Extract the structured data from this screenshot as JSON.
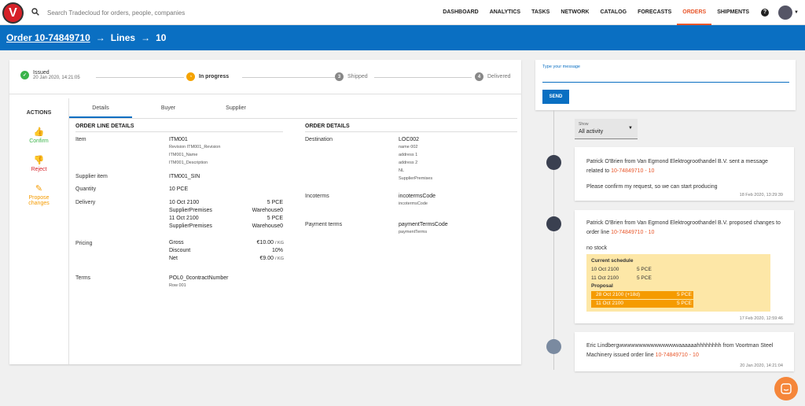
{
  "topbar": {
    "logo_letter": "V",
    "search_placeholder": "Search Tradecloud for orders, people, companies",
    "nav": [
      {
        "label": "DASHBOARD",
        "active": false
      },
      {
        "label": "ANALYTICS",
        "active": false
      },
      {
        "label": "TASKS",
        "active": false
      },
      {
        "label": "NETWORK",
        "active": false
      },
      {
        "label": "CATALOG",
        "active": false
      },
      {
        "label": "FORECASTS",
        "active": false
      },
      {
        "label": "ORDERS",
        "active": true
      },
      {
        "label": "SHIPMENTS",
        "active": false
      }
    ],
    "help_icon": "?",
    "accent_color": "#e8562a"
  },
  "breadcrumb": {
    "order": "Order 10-74849710",
    "lines": "Lines",
    "line_no": "10",
    "color": "#0a6fc2"
  },
  "stepper": {
    "issued": {
      "label": "Issued",
      "date": "20 Jan 2020, 14:21:05"
    },
    "in_progress": {
      "label": "In progress"
    },
    "shipped": {
      "number": "3",
      "label": "Shipped"
    },
    "delivered": {
      "number": "4",
      "label": "Delivered"
    }
  },
  "actions": {
    "title": "ACTIONS",
    "confirm": "Confirm",
    "reject": "Reject",
    "propose_line1": "Propose",
    "propose_line2": "changes"
  },
  "tabs": [
    "Details",
    "Buyer",
    "Supplier"
  ],
  "order_line": {
    "title": "ORDER LINE DETAILS",
    "item_label": "Item",
    "item": "ITM001",
    "item_revision": "Revision ITM001_Revision",
    "item_name": "ITM001_Name",
    "item_description": "ITM001_Description",
    "supplier_item_label": "Supplier item",
    "supplier_item": "ITM001_SIN",
    "quantity_label": "Quantity",
    "quantity": "10 PCE",
    "delivery_label": "Delivery",
    "delivery": [
      {
        "date": "10 Oct 2100",
        "qty": "5 PCE",
        "loc": "SupplierPremises",
        "wh": "Warehouse0"
      },
      {
        "date": "11 Oct 2100",
        "qty": "5 PCE",
        "loc": "SupplierPremises",
        "wh": "Warehouse0"
      }
    ],
    "pricing_label": "Pricing",
    "gross_label": "Gross",
    "gross": "€10.00",
    "gross_unit": "/ KG",
    "discount_label": "Discount",
    "discount": "10%",
    "net_label": "Net",
    "net": "€9.00",
    "net_unit": "/ KG",
    "terms_label": "Terms",
    "terms": "POL0_0contractNumber",
    "terms_row": "Row 001"
  },
  "order_details": {
    "title": "ORDER DETAILS",
    "destination_label": "Destination",
    "destination": "LOC002",
    "dest_name": "name 002",
    "dest_addr1": "address 1",
    "dest_addr2": "address 2",
    "dest_country": "NL",
    "dest_premises": "SupplierPremises",
    "incoterms_label": "Incoterms",
    "incoterms": "incotermsCode",
    "incoterms_sub": "incotermsCode",
    "payment_label": "Payment terms",
    "payment": "paymentTermsCode",
    "payment_sub": "paymentTerms"
  },
  "message": {
    "label": "Type your message",
    "send": "SEND"
  },
  "filter": {
    "label": "Show",
    "value": "All activity"
  },
  "activity": [
    {
      "text": "Patrick O'Brien from Van Egmond Elektrogroothandel B.V. sent a message related to",
      "link": "10-74849710 - 10",
      "body": "Please confirm my request, so we can start producing",
      "time": "18 Feb 2020, 13:29:39"
    },
    {
      "text": "Patrick O'Brien from Van Egmond Elektrogroothandel B.V. proposed changes to order line",
      "link": "10-74849710 - 10",
      "body": "no stock",
      "current_title": "Current schedule",
      "current": [
        {
          "date": "10 Oct 2100",
          "qty": "5 PCE"
        },
        {
          "date": "11 Oct 2100",
          "qty": "5 PCE"
        }
      ],
      "proposal_title": "Proposal",
      "proposal": [
        {
          "date": "28 Oct 2100 (+18d)",
          "qty": "5 PCE"
        },
        {
          "date": "11 Oct 2100",
          "qty": "5 PCE"
        }
      ],
      "time": "17 Feb 2020, 12:59:46"
    },
    {
      "text": "Eric Lindbergwwwwwwwwwwwwwwwaaaaaahhhhhhhh from Voortman Steel Machinery issued order line",
      "link": "10-74849710 - 10",
      "time": "20 Jan 2020, 14:21:04"
    }
  ]
}
